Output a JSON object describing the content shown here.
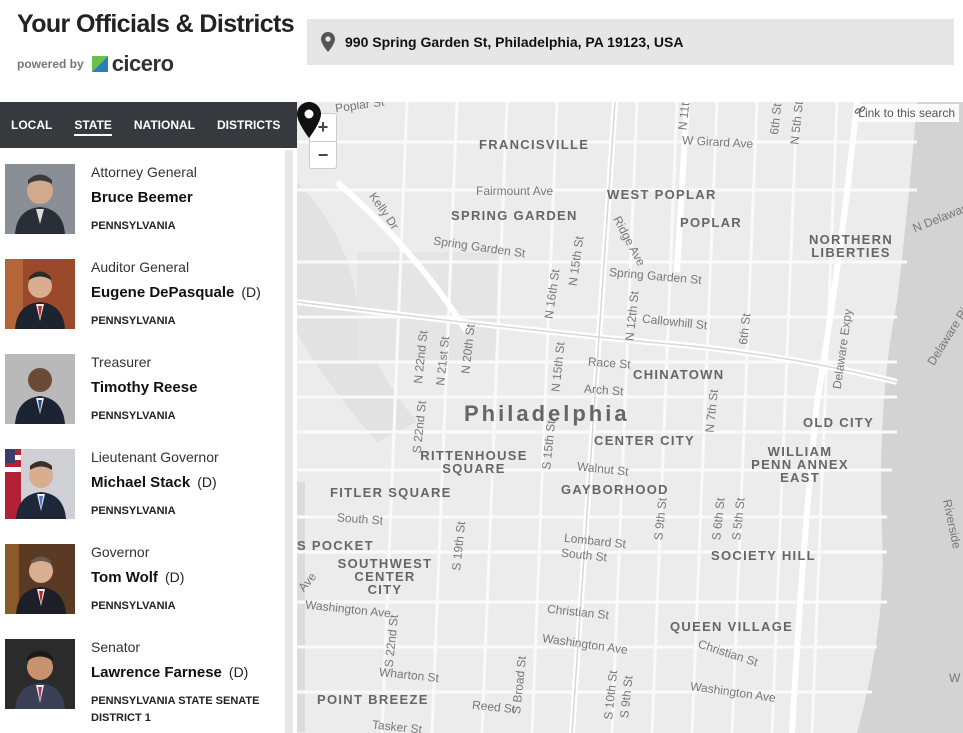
{
  "header": {
    "title": "Your Officials & Districts",
    "powered_by": "powered by",
    "brand": "cicero"
  },
  "address": "990 Spring Garden St, Philadelphia, PA 19123, USA",
  "tabs": [
    {
      "label": "LOCAL",
      "active": false
    },
    {
      "label": "STATE",
      "active": true
    },
    {
      "label": "NATIONAL",
      "active": false
    },
    {
      "label": "DISTRICTS",
      "active": false
    }
  ],
  "officials": [
    {
      "office": "Attorney General",
      "name": "Bruce Beemer",
      "party": "",
      "district": "PENNSYLVANIA"
    },
    {
      "office": "Auditor General",
      "name": "Eugene DePasquale",
      "party": "(D)",
      "district": "PENNSYLVANIA"
    },
    {
      "office": "Treasurer",
      "name": "Timothy Reese",
      "party": "",
      "district": "PENNSYLVANIA"
    },
    {
      "office": "Lieutenant Governor",
      "name": "Michael Stack",
      "party": "(D)",
      "district": "PENNSYLVANIA"
    },
    {
      "office": "Governor",
      "name": "Tom Wolf",
      "party": "(D)",
      "district": "PENNSYLVANIA"
    },
    {
      "office": "Senator",
      "name": "Lawrence Farnese",
      "party": "(D)",
      "district": "PENNSYLVANIA STATE SENATE DISTRICT 1"
    }
  ],
  "map": {
    "zoom_in": "+",
    "zoom_out": "−",
    "link_label": "Link to this search",
    "city": "Philadelphia",
    "neighborhoods": [
      "FRANCISVILLE",
      "WEST POPLAR",
      "SPRING GARDEN",
      "POPLAR",
      "NORTHERN LIBERTIES",
      "CHINATOWN",
      "CENTER CITY",
      "OLD CITY",
      "RITTENHOUSE SQUARE",
      "WILLIAM PENN ANNEX EAST",
      "FITLER SQUARE",
      "GAYBORHOOD",
      "S POCKET",
      "SOUTHWEST CENTER CITY",
      "SOCIETY HILL",
      "QUEEN VILLAGE",
      "POINT BREEZE"
    ],
    "streets": [
      "Poplar St",
      "N 11th",
      "6th St",
      "N 5th St",
      "W Girard Ave",
      "Fairmount Ave",
      "Kelly Dr",
      "Spring Garden St",
      "Spring Garden St",
      "Ridge Ave",
      "N 16th St",
      "N 15th St",
      "N 12th St",
      "Callowhill St",
      "6th St",
      "N Delaware",
      "Delaware Expy",
      "Delaware Rive",
      "N 22nd St",
      "N 21st St",
      "N 20th St",
      "N 15th St",
      "Race St",
      "Arch St",
      "N 7th St",
      "S 22nd St",
      "S 15th St",
      "Walnut St",
      "South St",
      "S 19th St",
      "Lombard St",
      "South St",
      "S 9th St",
      "S 6th St",
      "S 5th St",
      "Washington Ave",
      "S 22nd St",
      "Christian St",
      "Washington Ave",
      "Christian St",
      "Wharton St",
      "S Broad St",
      "S 10th St",
      "S 9th St",
      "Washington Ave",
      "Reed St",
      "Tasker St",
      "Ave",
      "Riverside",
      "W"
    ]
  },
  "colors": {
    "tab_bar": "#36393d",
    "address_bg": "#e6e6e6",
    "map_bg": "#ececec",
    "cicero_green": "#6cc04a"
  }
}
